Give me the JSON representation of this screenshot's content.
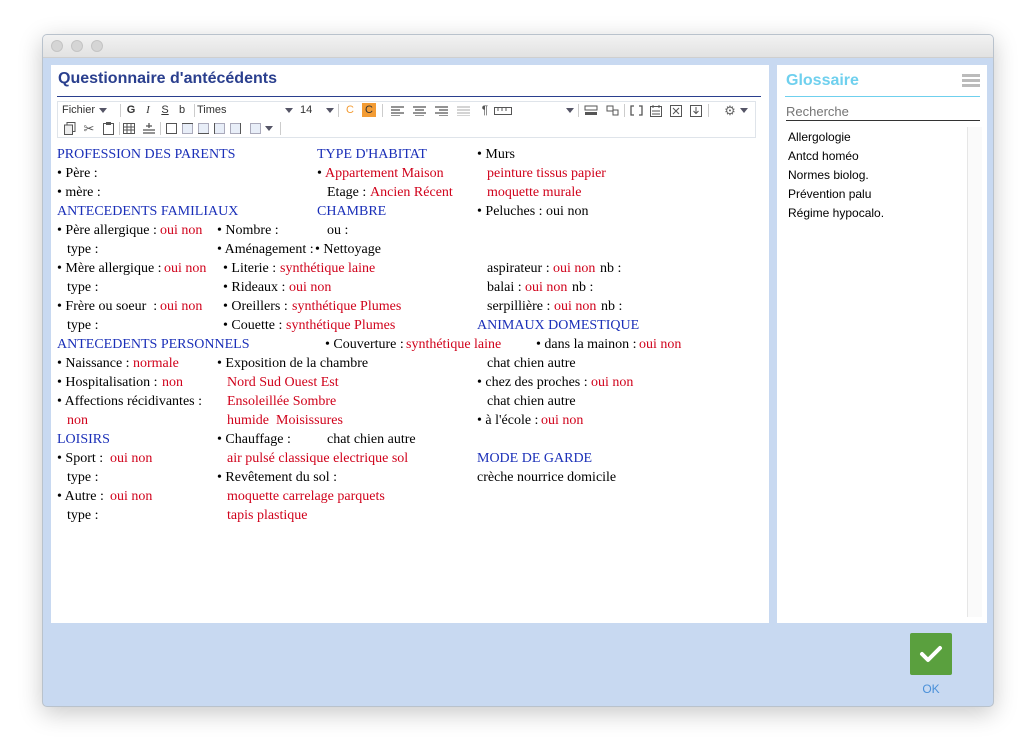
{
  "window": {
    "title": ""
  },
  "editor": {
    "title": "Questionnaire d'antécédents",
    "toolbar": {
      "file_menu": "Fichier",
      "bold": "G",
      "italic": "I",
      "underline": "S",
      "strike": "b",
      "font_family": "Times",
      "font_size": "14",
      "text_color_label": "C",
      "bg_color_label": "C",
      "accent_color": "#f39c34"
    },
    "colors": {
      "heading": "#1a2fb8",
      "option": "#d0021b",
      "title": "#2a3f8e"
    },
    "lines": {
      "c1": [
        "PROFESSION DES PARENTS",
        "• Père :",
        "• mère :",
        "ANTECEDENTS FAMILIAUX",
        "• Père allergique :",
        "oui non",
        "type :",
        "• Mère allergique :",
        "oui non",
        "type :",
        "• Frère ou soeur  :",
        "oui non",
        "type :",
        "ANTECEDENTS PERSONNELS",
        "• Naissance :",
        "normale",
        "• Hospitalisation :",
        "non",
        "• Affections récidivantes :",
        "non",
        "LOISIRS",
        "• Sport :",
        "oui non",
        "type :",
        "• Autre :",
        "oui non",
        "type :"
      ],
      "c2": [
        "TYPE D'HABITAT",
        "• ",
        "Appartement Maison",
        "Etage :",
        "Ancien Récent",
        "CHAMBRE",
        "• Nombre :",
        "ou :",
        "• Aménagement :",
        "• Nettoyage",
        "• Literie :",
        "synthétique laine",
        "• Rideaux :",
        "oui non",
        "• Oreillers :",
        "synthétique Plumes",
        "• Couette :",
        "synthétique Plumes",
        "• Couverture :",
        "synthétique laine",
        "• Exposition de la chambre",
        "Nord Sud Ouest Est",
        "Ensoleillée Sombre",
        "humide  Moisissures",
        "• Chauffage :",
        "chat chien autre",
        "air pulsé classique electrique sol",
        "• Revêtement du sol :",
        "moquette carrelage parquets",
        "tapis plastique"
      ],
      "c3": [
        "• Murs",
        "peinture tissus papier",
        "moquette murale",
        "• Peluches : oui non",
        "aspirateur :",
        "oui non",
        "nb :",
        "balai :",
        "oui non",
        "nb :",
        "serpillière :",
        "oui non",
        "nb :",
        "ANIMAUX DOMESTIQUE",
        "• dans la mainon :",
        "oui non",
        "chat chien autre",
        "• chez des proches :",
        "oui non",
        "chat chien autre",
        "• à l'école :",
        "oui non",
        "MODE DE GARDE",
        "crèche nourrice domicile"
      ]
    }
  },
  "glossary": {
    "title": "Glossaire",
    "search_placeholder": "Recherche",
    "accent": "#6fd0ee",
    "items": [
      "Allergologie",
      "Antcd homéo",
      "Normes biolog.",
      "Prévention palu",
      "Régime hypocalo."
    ]
  },
  "ok": {
    "label": "OK",
    "color": "#5aa03e"
  }
}
